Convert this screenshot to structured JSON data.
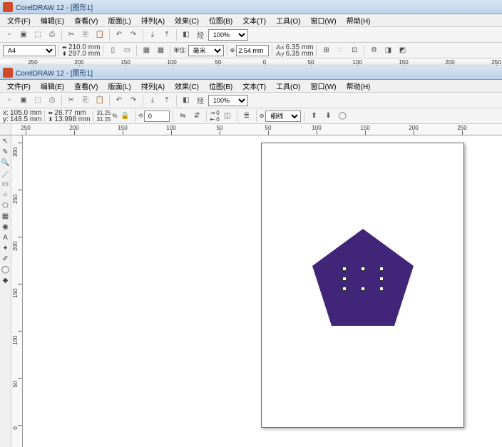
{
  "app": {
    "name": "CorelDRAW 12",
    "doc": "图形1"
  },
  "menus": [
    "文件(F)",
    "编辑(E)",
    "查看(V)",
    "版面(L)",
    "排列(A)",
    "效果(C)",
    "位图(B)",
    "文本(T)",
    "工具(O)",
    "窗口(W)",
    "帮助(H)"
  ],
  "toolbar1": {
    "zoom": "100%"
  },
  "propbar1": {
    "paper": "A4",
    "w": "210.0 mm",
    "h": "297.0 mm",
    "unit_label": "单位:",
    "unit": "毫米",
    "nudge": "2.54 mm",
    "dupx": "6.35 mm",
    "dupy": "6.35 mm"
  },
  "ruler1": {
    "vals": [
      "250",
      "200",
      "150",
      "100",
      "50",
      "0",
      "50",
      "100",
      "150",
      "200",
      "250"
    ]
  },
  "toolbar2": {
    "zoom": "100%"
  },
  "propbar2": {
    "x_label": "x:",
    "x": "105.0 mm",
    "y_label": "y:",
    "y": "148.5 mm",
    "w": "26.77 mm",
    "h": "13.998 mm",
    "sx": "31.25",
    "sy": "31.25",
    "rot": ".0",
    "outline": "细线"
  },
  "ruler2h": {
    "vals": [
      "250",
      "200",
      "150",
      "100",
      "50",
      "50",
      "100",
      "150",
      "200",
      "250"
    ]
  },
  "ruler2v": {
    "vals": [
      "300",
      "250",
      "200",
      "150",
      "100",
      "50",
      "0"
    ]
  },
  "tools": [
    "pick",
    "shape",
    "zoom",
    "freehand",
    "rect",
    "ellipse",
    "polygon",
    "graph",
    "spiral",
    "text",
    "interactive",
    "eyedrop",
    "outline",
    "fill"
  ]
}
